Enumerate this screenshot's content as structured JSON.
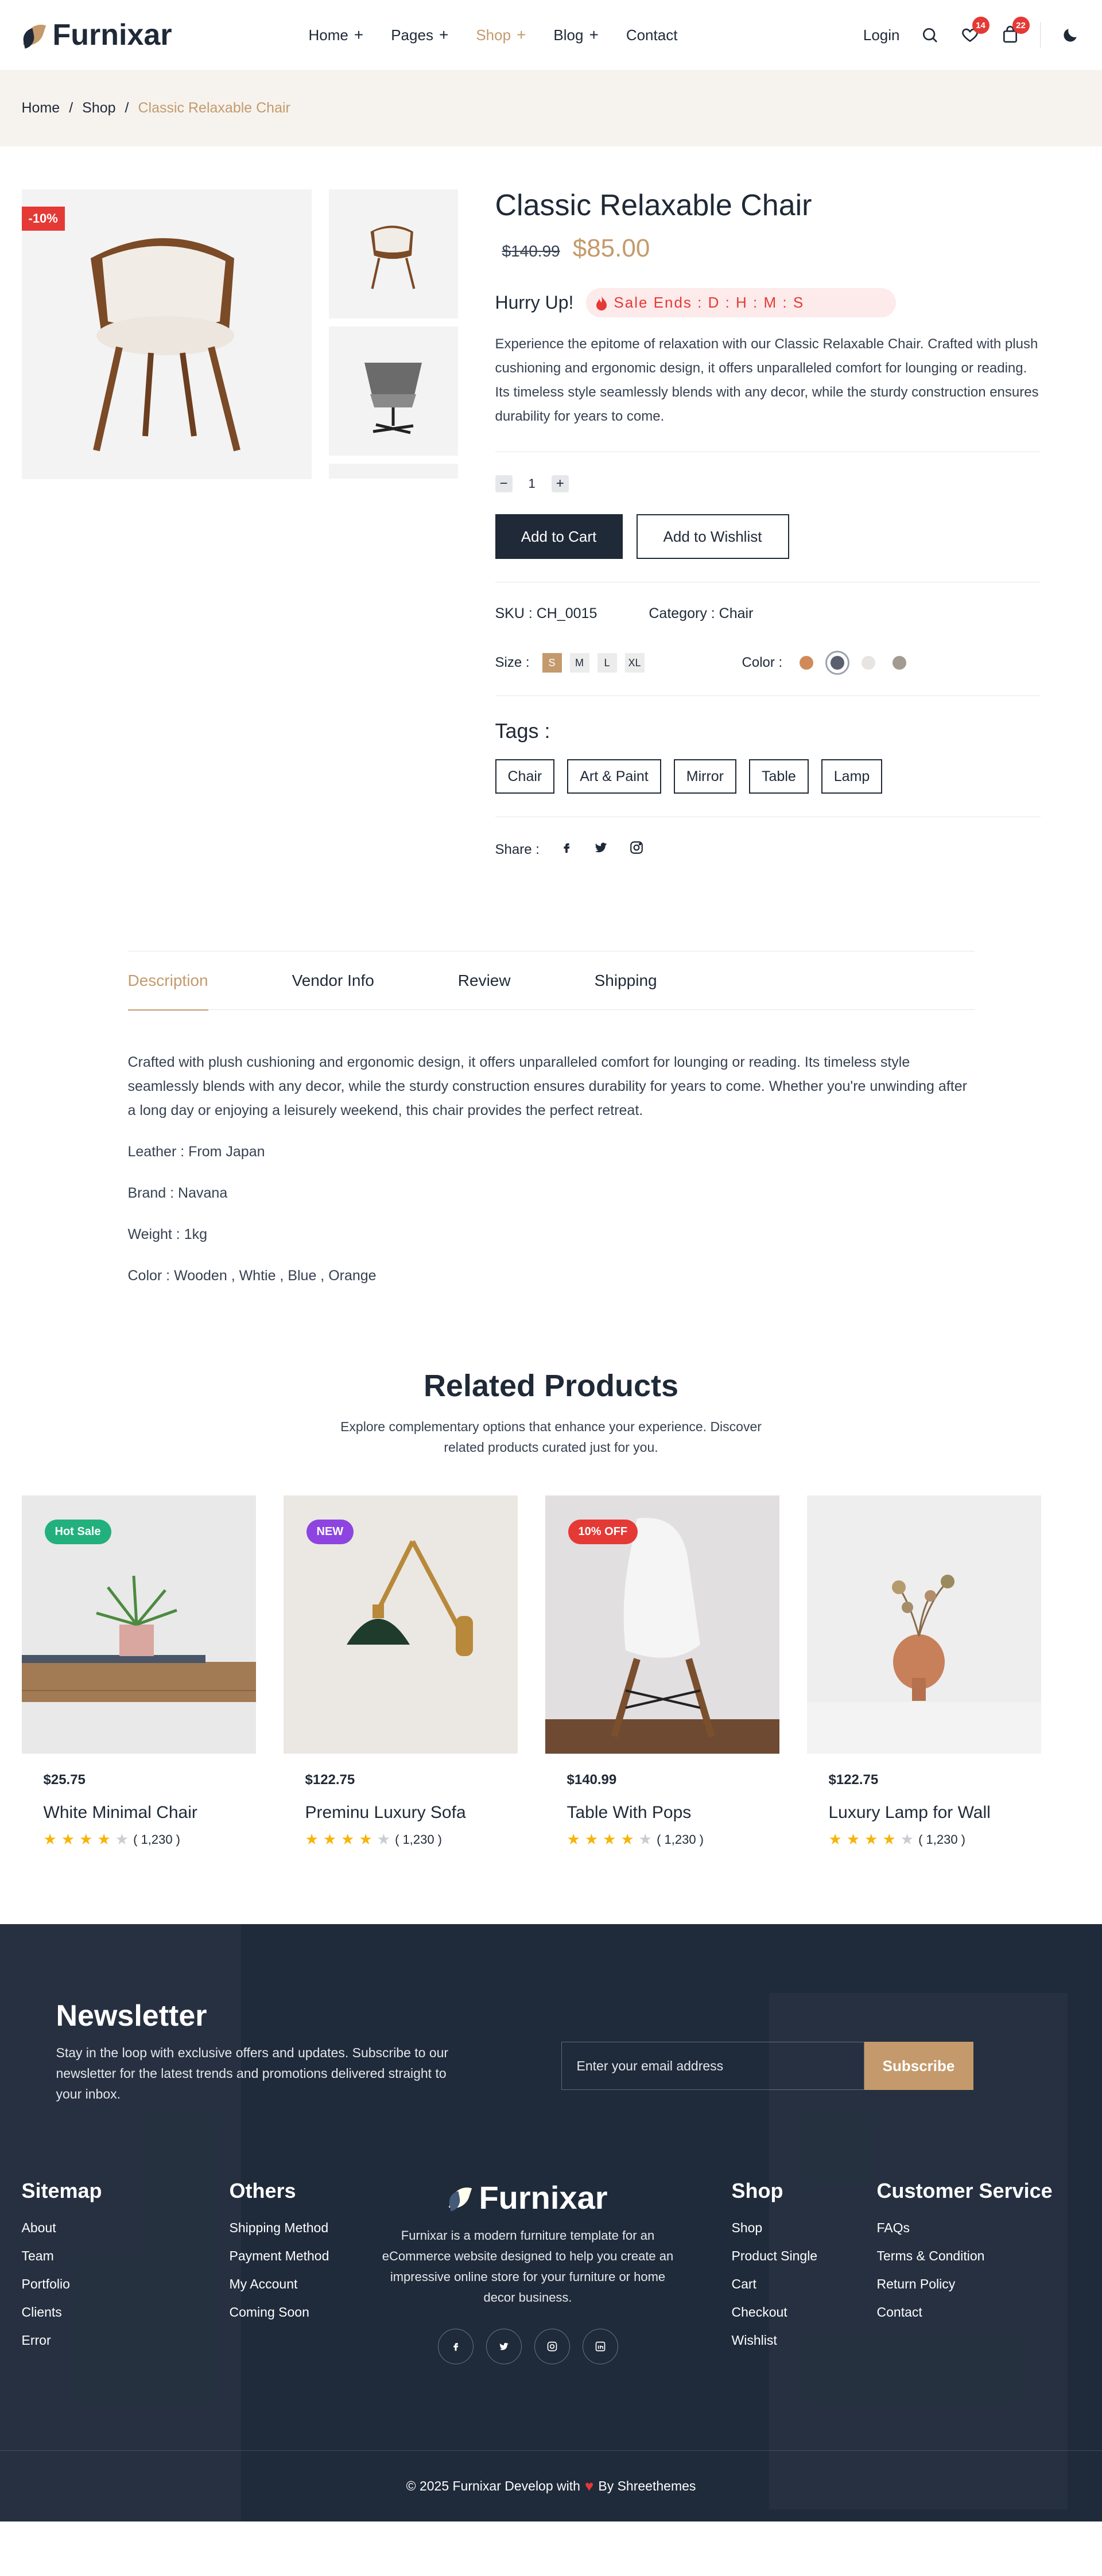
{
  "header": {
    "logo": "Furnixar",
    "nav": [
      {
        "label": "Home",
        "has_submenu": true
      },
      {
        "label": "Pages",
        "has_submenu": true
      },
      {
        "label": "Shop",
        "has_submenu": true,
        "active": true
      },
      {
        "label": "Blog",
        "has_submenu": true
      },
      {
        "label": "Contact",
        "has_submenu": false
      }
    ],
    "login": "Login",
    "wishlist_count": "14",
    "cart_count": "22"
  },
  "breadcrumb": {
    "home": "Home",
    "sep": "/",
    "shop": "Shop",
    "current": "Classic Relaxable Chair"
  },
  "product": {
    "discount": "-10%",
    "title": "Classic Relaxable Chair",
    "old_price": "$140.99",
    "new_price": "$85.00",
    "hurry": "Hurry Up!",
    "sale_ends": "Sale Ends : D : H : M : S",
    "description": "Experience the epitome of relaxation with our Classic Relaxable Chair. Crafted with plush cushioning and ergonomic design, it offers unparalleled comfort for lounging or reading. Its timeless style seamlessly blends with any decor, while the sturdy construction ensures durability for years to come.",
    "qty_minus": "−",
    "qty": "1",
    "qty_plus": "+",
    "add_to_cart": "Add to Cart",
    "add_to_wishlist": "Add to Wishlist",
    "sku": "SKU : CH_0015",
    "category": "Category : Chair",
    "size_label": "Size :",
    "sizes": [
      "S",
      "M",
      "L",
      "XL"
    ],
    "color_label": "Color :",
    "colors": [
      "#d08a5a",
      "#5b6070",
      "#e7e4e1",
      "#a39a92"
    ],
    "tags_label": "Tags :",
    "tags": [
      "Chair",
      "Art & Paint",
      "Mirror",
      "Table",
      "Lamp"
    ],
    "share_label": "Share :"
  },
  "tabs": {
    "items": [
      "Description",
      "Vendor Info",
      "Review",
      "Shipping"
    ],
    "body": "Crafted with plush cushioning and ergonomic design, it offers unparalleled comfort for lounging or reading. Its timeless style seamlessly blends with any decor, while the sturdy construction ensures durability for years to come. Whether you're unwinding after a long day or enjoying a leisurely weekend, this chair provides the perfect retreat.",
    "specs": [
      "Leather : From Japan",
      "Brand : Navana",
      "Weight : 1kg",
      "Color : Wooden , Whtie , Blue , Orange"
    ]
  },
  "related": {
    "title": "Related Products",
    "subtitle": "Explore complementary options that enhance your experience. Discover related products curated just for you.",
    "products": [
      {
        "badge": "Hot Sale",
        "badge_color": "#22b07d",
        "price": "$25.75",
        "name": "White Minimal Chair",
        "rating": 4,
        "reviews": "( 1,230 )"
      },
      {
        "badge": "NEW",
        "badge_color": "#8e44e0",
        "price": "$122.75",
        "name": "Preminu Luxury Sofa",
        "rating": 4,
        "reviews": "( 1,230 )"
      },
      {
        "badge": "10% OFF",
        "badge_color": "#e53935",
        "price": "$140.99",
        "name": "Table With Pops",
        "rating": 4,
        "reviews": "( 1,230 )"
      },
      {
        "badge": "",
        "badge_color": "",
        "price": "$122.75",
        "name": "Luxury Lamp for Wall",
        "rating": 4,
        "reviews": "( 1,230 )"
      }
    ]
  },
  "footer": {
    "newsletter_title": "Newsletter",
    "newsletter_text": "Stay in the loop with exclusive offers and updates. Subscribe to our newsletter for the latest trends and promotions delivered straight to your inbox.",
    "email_placeholder": "Enter your email address",
    "subscribe": "Subscribe",
    "sitemap_title": "Sitemap",
    "sitemap": [
      "About",
      "Team",
      "Portfolio",
      "Clients",
      "Error"
    ],
    "others_title": "Others",
    "others": [
      "Shipping Method",
      "Payment Method",
      "My Account",
      "Coming Soon"
    ],
    "logo": "Furnixar",
    "about": "Furnixar is a modern furniture template for an eCommerce website designed to help you create an impressive online store for your furniture or home decor business.",
    "shop_title": "Shop",
    "shop": [
      "Shop",
      "Product Single",
      "Cart",
      "Checkout",
      "Wishlist"
    ],
    "service_title": "Customer Service",
    "service": [
      "FAQs",
      "Terms & Condition",
      "Return Policy",
      "Contact"
    ],
    "copyright_left": "© 2025 Furnixar Develop with",
    "copyright_right": "By Shreethemes"
  }
}
